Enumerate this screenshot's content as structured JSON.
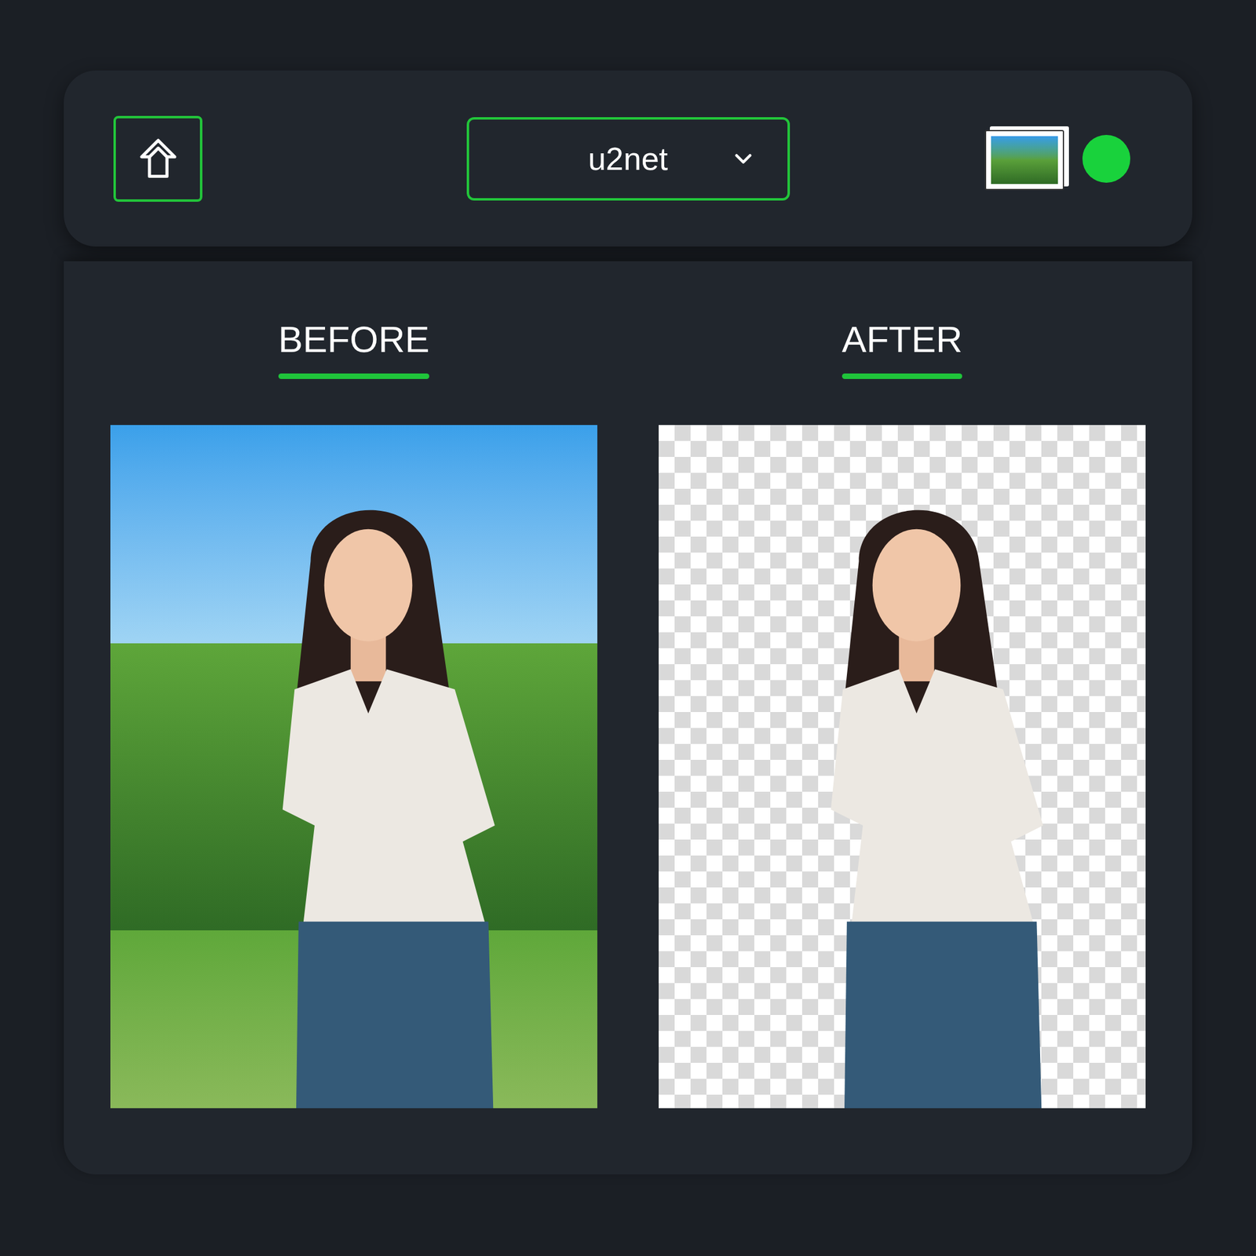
{
  "toolbar": {
    "model": {
      "value": "u2net",
      "expanded": false
    },
    "status": {
      "active": true
    }
  },
  "panels": [
    {
      "label": "BEFORE",
      "kind": "photo"
    },
    {
      "label": "AFTER",
      "kind": "cutout"
    }
  ]
}
